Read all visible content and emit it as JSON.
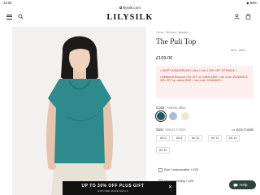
{
  "status_bar": {
    "time": "14:02",
    "right": "◆ 84%"
  },
  "browser": {
    "url": "lilysilk.com"
  },
  "header": {
    "logo": "LILYSILK"
  },
  "breadcrumb": "Home  /  Women  /  Apparel",
  "product": {
    "title": "The Puli Top",
    "sku_label": "SKU : 8812",
    "price": "£109.00"
  },
  "promo": {
    "line1": "• HAPPY ANNIVERSARY | Buy 1 Get 1 25% OFF SITEWIDE >",
    "line2": "• Additional Discount | 5% OFF on orders £260+; use code: WOWW575; 30% OFF on orders £500+; see code: SOMAN20 >"
  },
  "color": {
    "label": "Color:",
    "value": "Antistic Blue",
    "swatches": [
      {
        "name": "teal",
        "hex": "#1f5a62",
        "selected": true
      },
      {
        "name": "light-blue",
        "hex": "#a9bbd6",
        "selected": false
      },
      {
        "name": "cream",
        "hex": "#ece6d6",
        "selected": false
      }
    ]
  },
  "size": {
    "label": "Size:",
    "value": "Select A Size",
    "guide": "Size Guide",
    "options": [
      "UK 6",
      "UK 8",
      "UK 10",
      "UK 12",
      "UK 14",
      "UK 16"
    ]
  },
  "options": {
    "customization": "Size Customization + £25",
    "monogramming": "Monogramming + £25"
  },
  "banner": {
    "main": "UP TO 30% OFF PLUS GIFT",
    "sub": "EXPLORE MORE DEALS",
    "close": "✕"
  },
  "help": {
    "label": "Help"
  },
  "colors": {
    "accent": "#2e4240",
    "promo_text": "#c0392b",
    "promo_bg": "#fdf0ef",
    "blouse": "#2f8a8c"
  }
}
